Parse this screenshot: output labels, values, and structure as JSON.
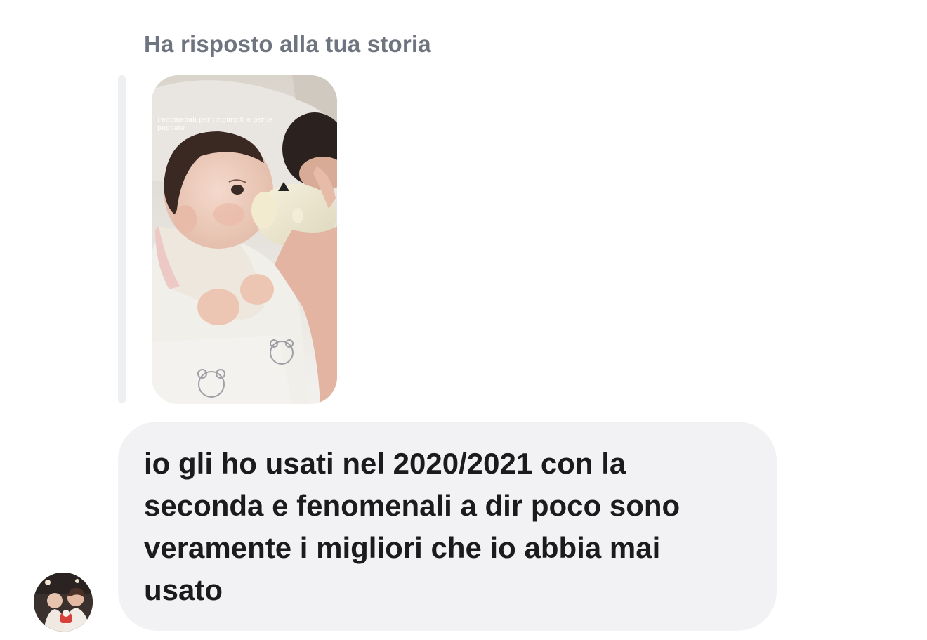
{
  "story_reply": {
    "label": "Ha risposto alla tua storia",
    "story_caption": "Fenomenali per i rigurgiti e per le poppate"
  },
  "message": {
    "text": "io gli ho usati nel 2020/2021 con la\nseconda e fenomenali a dir poco sono\nveramente i migliori che io abbia mai\nusato"
  },
  "colors": {
    "bubble_bg": "#f2f2f4",
    "label_text": "#6e7480",
    "message_text": "#1b1b1d",
    "quote_bar": "#eeeff1"
  },
  "icons": {
    "avatar": "user-avatar-photo",
    "story": "story-thumbnail-photo"
  }
}
